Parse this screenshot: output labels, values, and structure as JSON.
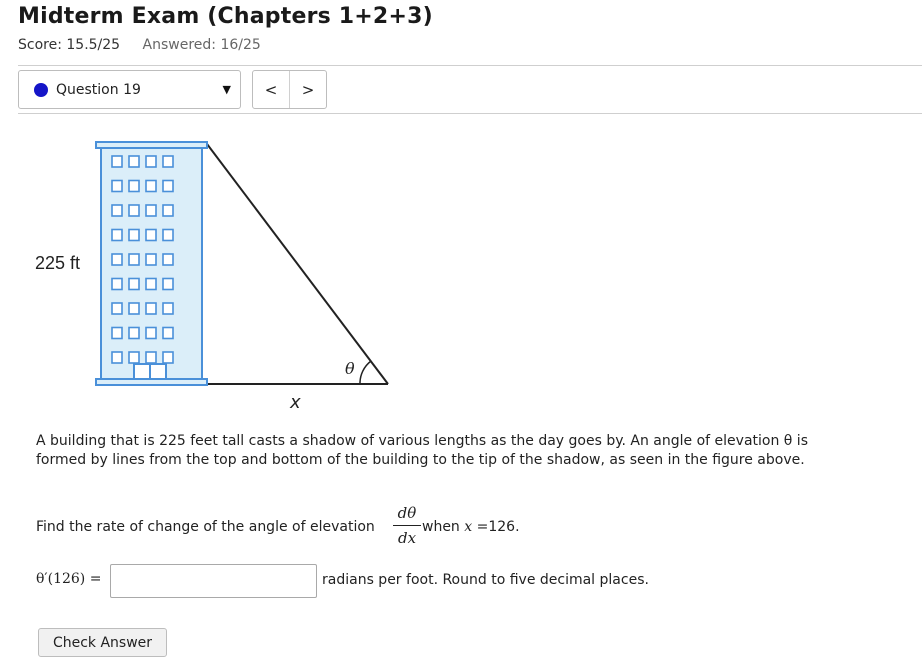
{
  "header": {
    "title": "Midterm Exam (Chapters 1+2+3)",
    "score": "Score: 15.5/25",
    "answered": "Answered: 16/25"
  },
  "navigation": {
    "question_label": "Question 19",
    "caret": "▼",
    "prev": "<",
    "next": ">"
  },
  "figure": {
    "height_label": "225 ft",
    "angle_label": "θ",
    "shadow_label": "x",
    "building_color": "#4a90d9",
    "building_fill": "#dbeef9"
  },
  "problem": {
    "text": "A building that is 225 feet tall casts a shadow of various lengths as the day goes by. An angle of elevation θ is formed by lines from the top and bottom of the building to the tip of the shadow, as seen in the figure above.",
    "find_text": "Find the rate of change of the angle of elevation",
    "frac_num": "dθ",
    "frac_den": "dx",
    "when_text": "when",
    "var_x": "x",
    "x_value": "=126.",
    "answer_label": "θ′(126) =",
    "answer_value": "",
    "units": "radians per foot. Round to five decimal places."
  },
  "actions": {
    "check_answer": "Check Answer"
  }
}
